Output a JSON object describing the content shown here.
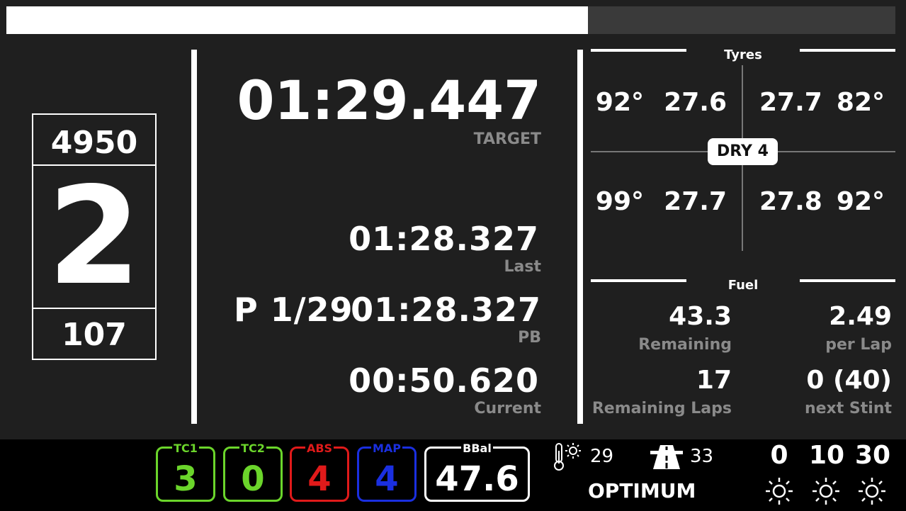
{
  "progress": {
    "fraction": 0.654,
    "fill_color": "#ffffff",
    "track_color": "#3a3a3a"
  },
  "rpm_box": {
    "rpm": "4950",
    "gear": "2",
    "speed": "107"
  },
  "laptimes": {
    "target_value": "01:29.447",
    "target_label": "TARGET",
    "last_value": "01:28.327",
    "last_label": "Last",
    "pb_value": "01:28.327",
    "pb_label": "PB",
    "current_value": "00:50.620",
    "current_label": "Current",
    "position": "P 1/29"
  },
  "tyres": {
    "title": "Tyres",
    "compound": "DRY 4",
    "fl_temp": "92°",
    "fl_pressure": "27.6",
    "fr_pressure": "27.7",
    "fr_temp": "82°",
    "rl_temp": "99°",
    "rl_pressure": "27.7",
    "rr_pressure": "27.8",
    "rr_temp": "92°"
  },
  "fuel": {
    "title": "Fuel",
    "remaining_value": "43.3",
    "remaining_label": "Remaining",
    "per_lap_value": "2.49",
    "per_lap_label": "per Lap",
    "remaining_laps_value": "17",
    "remaining_laps_label": "Remaining Laps",
    "next_stint_value": "0 (40)",
    "next_stint_label": "next Stint"
  },
  "bottom": {
    "tc1": {
      "label": "TC1",
      "value": "3",
      "color": "#6bd52b"
    },
    "tc2": {
      "label": "TC2",
      "value": "0",
      "color": "#6bd52b"
    },
    "abs": {
      "label": "ABS",
      "value": "4",
      "color": "#e01a1a"
    },
    "map": {
      "label": "MAP",
      "value": "4",
      "color": "#1a2fe0"
    },
    "bbal": {
      "label": "BBal",
      "value": "47.6",
      "color": "#ffffff"
    },
    "air_temp": "29",
    "track_temp": "33",
    "track_condition": "OPTIMUM",
    "weather": [
      "0",
      "10",
      "30"
    ],
    "icons": {
      "air": "thermometer-sun-icon",
      "track": "road-icon",
      "weather": "sun-icon"
    }
  }
}
